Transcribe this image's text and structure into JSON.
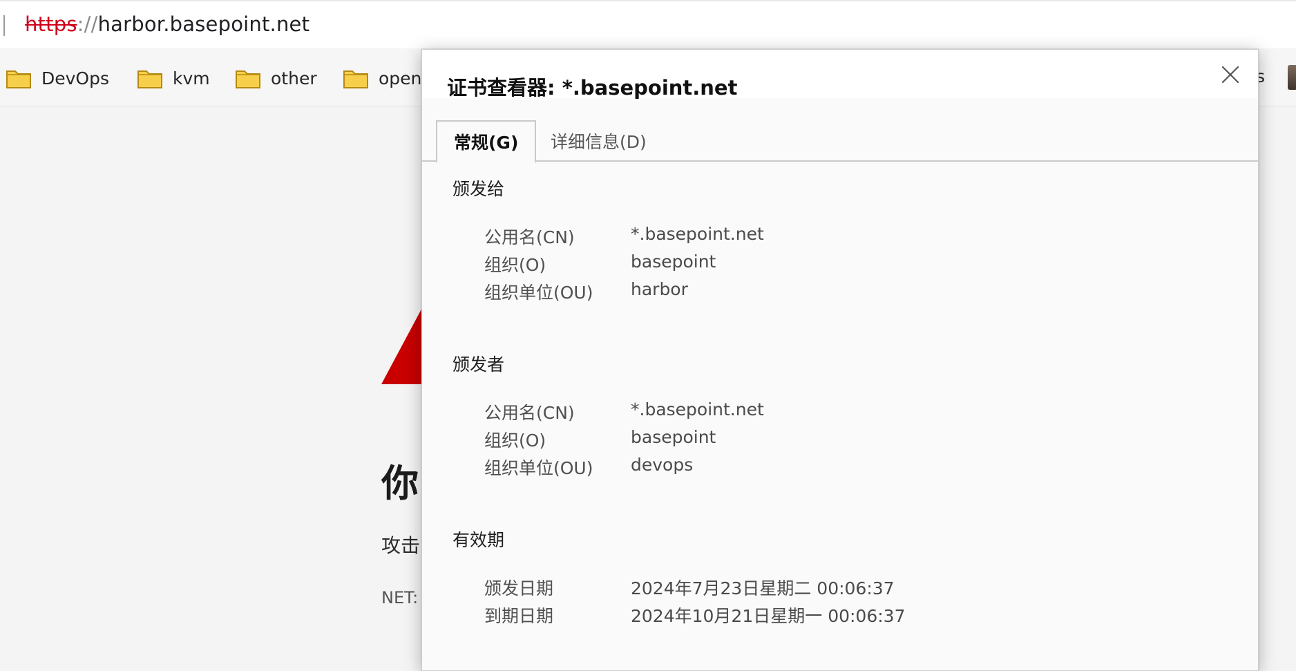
{
  "address_bar": {
    "scheme": "https",
    "separator": "://",
    "host": "harbor.basepoint.net"
  },
  "bookmarks": {
    "items": [
      {
        "label": "DevOps",
        "icon": "folder-icon"
      },
      {
        "label": "kvm",
        "icon": "folder-icon"
      },
      {
        "label": "other",
        "icon": "folder-icon"
      },
      {
        "label": "open",
        "icon": "folder-icon"
      }
    ],
    "trailing_fragment": "s"
  },
  "background_page": {
    "title_fragment": "你",
    "text_fragment": "攻击",
    "code_fragment": "NET:"
  },
  "dialog": {
    "title": "证书查看器: *.basepoint.net",
    "tabs": [
      {
        "label": "常规(G)",
        "active": true
      },
      {
        "label": "详细信息(D)",
        "active": false
      }
    ],
    "issued_to": {
      "heading": "颁发给",
      "rows": [
        {
          "label": "公用名(CN)",
          "value": "*.basepoint.net"
        },
        {
          "label": "组织(O)",
          "value": "basepoint"
        },
        {
          "label": "组织单位(OU)",
          "value": "harbor"
        }
      ]
    },
    "issued_by": {
      "heading": "颁发者",
      "rows": [
        {
          "label": "公用名(CN)",
          "value": "*.basepoint.net"
        },
        {
          "label": "组织(O)",
          "value": "basepoint"
        },
        {
          "label": "组织单位(OU)",
          "value": "devops"
        }
      ]
    },
    "validity": {
      "heading": "有效期",
      "rows": [
        {
          "label": "颁发日期",
          "value": "2024年7月23日星期二 00:06:37"
        },
        {
          "label": "到期日期",
          "value": "2024年10月21日星期一 00:06:37"
        }
      ]
    }
  },
  "colors": {
    "insecure_scheme": "#d0021b",
    "warning_red": "#c80000",
    "folder_fill": "#f7cf4a"
  }
}
